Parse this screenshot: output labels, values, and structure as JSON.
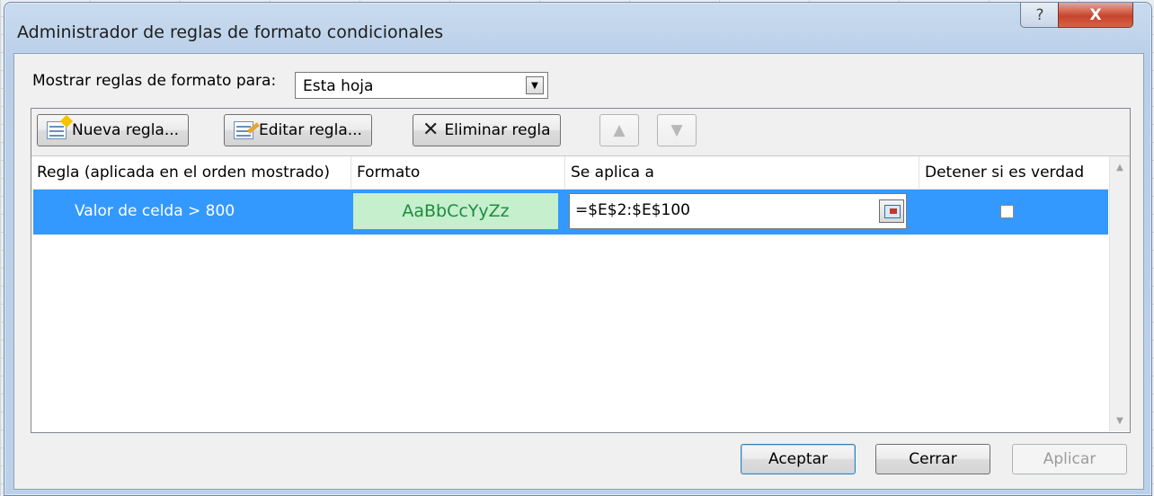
{
  "window": {
    "title": "Administrador de reglas de formato condicionales",
    "help_glyph": "?",
    "close_glyph": "X"
  },
  "show_rules": {
    "label": "Mostrar reglas de formato para:",
    "selected": "Esta hoja"
  },
  "toolbar": {
    "new_rule": "Nueva regla...",
    "edit_rule": "Editar regla...",
    "delete_rule": "Eliminar regla",
    "move_up_glyph": "▲",
    "move_down_glyph": "▼"
  },
  "table": {
    "headers": {
      "rule": "Regla (aplicada en el orden mostrado)",
      "format": "Formato",
      "applies_to": "Se aplica a",
      "stop_if_true": "Detener si es verdad"
    },
    "rows": [
      {
        "rule": "Valor de celda > 800",
        "format_preview": "AaBbCcYyZz",
        "applies_to": "=$E$2:$E$100",
        "stop_if_true": false
      }
    ]
  },
  "buttons": {
    "ok": "Aceptar",
    "close": "Cerrar",
    "apply": "Aplicar"
  },
  "colors": {
    "selection": "#3399ff",
    "format_fill": "#c6efce",
    "format_text": "#1e8c3e"
  }
}
